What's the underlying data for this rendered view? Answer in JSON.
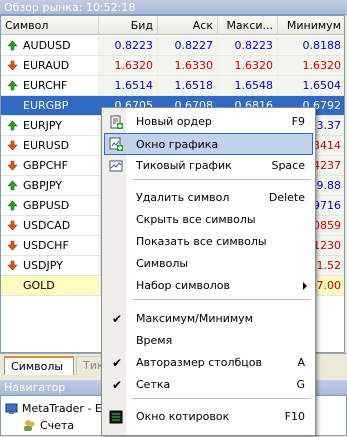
{
  "market_watch": {
    "title": "Обзор рынка: 10:52:18",
    "columns": [
      "Символ",
      "Бид",
      "Аск",
      "Макси...",
      "Минимум"
    ],
    "rows": [
      {
        "symbol": "AUDUSD",
        "dir": "up",
        "bid": "0.8223",
        "ask": "0.8227",
        "max": "0.8223",
        "min": "0.8188",
        "color": "#0000cc"
      },
      {
        "symbol": "EURAUD",
        "dir": "down",
        "bid": "1.6320",
        "ask": "1.6330",
        "max": "1.6320",
        "min": "1.6320",
        "color": "#cc0000"
      },
      {
        "symbol": "EURCHF",
        "dir": "up",
        "bid": "1.6514",
        "ask": "1.6518",
        "max": "1.6548",
        "min": "1.6504",
        "color": "#0000cc"
      },
      {
        "symbol": "EURGBP",
        "dir": "down",
        "bid": "0.6705",
        "ask": "0.6708",
        "max": "0.6816",
        "min": "0.6792",
        "color": "#ffffff"
      },
      {
        "symbol": "EURJPY",
        "dir": "up",
        "bid": "",
        "ask": "",
        "max": "",
        "min": "3.37",
        "color": "#0000cc"
      },
      {
        "symbol": "EURUSD",
        "dir": "down",
        "bid": "",
        "ask": "",
        "max": "",
        "min": ".3414",
        "color": "#cc0000"
      },
      {
        "symbol": "GBPCHF",
        "dir": "down",
        "bid": "",
        "ask": "",
        "max": "",
        "min": ".4237",
        "color": "#cc0000"
      },
      {
        "symbol": "GBPJPY",
        "dir": "up",
        "bid": "",
        "ask": "",
        "max": "",
        "min": "9.88",
        "color": "#0000cc"
      },
      {
        "symbol": "GBPUSD",
        "dir": "up",
        "bid": "",
        "ask": "",
        "max": "",
        "min": ".9716",
        "color": "#0000cc"
      },
      {
        "symbol": "USDCAD",
        "dir": "down",
        "bid": "",
        "ask": "",
        "max": "",
        "min": ".0859",
        "color": "#cc0000"
      },
      {
        "symbol": "USDCHF",
        "dir": "down",
        "bid": "",
        "ask": "",
        "max": "",
        "min": ".1230",
        "color": "#cc0000"
      },
      {
        "symbol": "USDJPY",
        "dir": "down",
        "bid": "",
        "ask": "",
        "max": "",
        "min": "1.52",
        "color": "#cc0000"
      },
      {
        "symbol": "GOLD",
        "dir": "up",
        "bid": "",
        "ask": "",
        "max": "",
        "min": "7.00",
        "color": "#cc0000"
      }
    ],
    "selected_index": 3,
    "tabs": [
      "Символы",
      "Тик"
    ]
  },
  "navigator": {
    "title": "Навигатор",
    "items": [
      "MetaTrader - E",
      "Счета"
    ]
  },
  "context_menu": {
    "items": [
      {
        "label": "Новый ордер",
        "shortcut": "F9",
        "icon": "new-order-icon"
      },
      {
        "label": "Окно графика",
        "shortcut": "",
        "icon": "chart-window-icon"
      },
      {
        "label": "Тиковый график",
        "shortcut": "Space",
        "icon": "tick-chart-icon"
      },
      {
        "label": "Удалить символ",
        "shortcut": "Delete"
      },
      {
        "label": "Скрыть все символы",
        "shortcut": ""
      },
      {
        "label": "Показать все символы",
        "shortcut": ""
      },
      {
        "label": "Символы",
        "shortcut": ""
      },
      {
        "label": "Набор символов",
        "shortcut": ""
      },
      {
        "label": "Максимум/Минимум",
        "shortcut": "",
        "checked": true
      },
      {
        "label": "Время",
        "shortcut": ""
      },
      {
        "label": "Авторазмер столбцов",
        "shortcut": "A",
        "checked": true
      },
      {
        "label": "Сетка",
        "shortcut": "G",
        "checked": true
      },
      {
        "label": "Окно котировок",
        "shortcut": "F10",
        "icon": "quotes-window-icon"
      }
    ],
    "highlighted_index": 1,
    "check_mark": "✔"
  }
}
